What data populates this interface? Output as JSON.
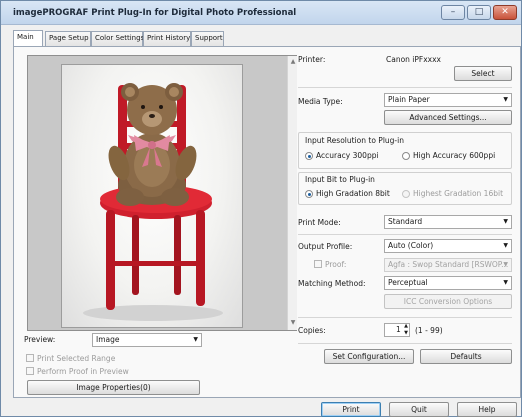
{
  "window": {
    "title": "imagePROGRAF Print Plug-In for Digital Photo Professional",
    "min_glyph": "–",
    "max_glyph": "□",
    "close_glyph": "✕"
  },
  "tabs": [
    {
      "label": "Main",
      "active": true
    },
    {
      "label": "Page Setup",
      "active": false
    },
    {
      "label": "Color Settings",
      "active": false
    },
    {
      "label": "Print History",
      "active": false
    },
    {
      "label": "Support",
      "active": false
    }
  ],
  "preview": {
    "label": "Preview:",
    "mode": "Image",
    "print_selected_range": "Print Selected Range",
    "perform_proof": "Perform Proof in Preview",
    "image_properties": "Image Properties(0)"
  },
  "printer": {
    "label": "Printer:",
    "name": "Canon iPFxxxx",
    "select_button": "Select"
  },
  "media": {
    "label": "Media Type:",
    "value": "Plain Paper",
    "advanced_button": "Advanced Settings..."
  },
  "resolution": {
    "title": "Input Resolution to Plug-in",
    "opt1": "Accuracy 300ppi",
    "opt2": "High Accuracy 600ppi",
    "selected": "Accuracy 300ppi"
  },
  "bit": {
    "title": "Input Bit to Plug-in",
    "opt1": "High Gradation 8bit",
    "opt2": "Highest Gradation 16bit",
    "selected": "High Gradation 8bit"
  },
  "print_mode": {
    "label": "Print Mode:",
    "value": "Standard"
  },
  "output_profile": {
    "label": "Output Profile:",
    "value": "Auto (Color)"
  },
  "proof": {
    "label": "Proof:",
    "value": "Agfa : Swop Standard  [RSWOP..."
  },
  "matching": {
    "label": "Matching Method:",
    "value": "Perceptual",
    "icc_button": "ICC Conversion Options"
  },
  "copies": {
    "label": "Copies:",
    "value": "1",
    "range": "(1 - 99)"
  },
  "buttons": {
    "set_configuration": "Set Configuration...",
    "defaults": "Defaults",
    "print": "Print",
    "quit": "Quit",
    "help": "Help"
  },
  "colors": {
    "title_bar": "#c2d5ec",
    "chair_red": "#d0202e",
    "bear_brown": "#8a6a48",
    "ribbon_pink": "#e28aa1"
  }
}
